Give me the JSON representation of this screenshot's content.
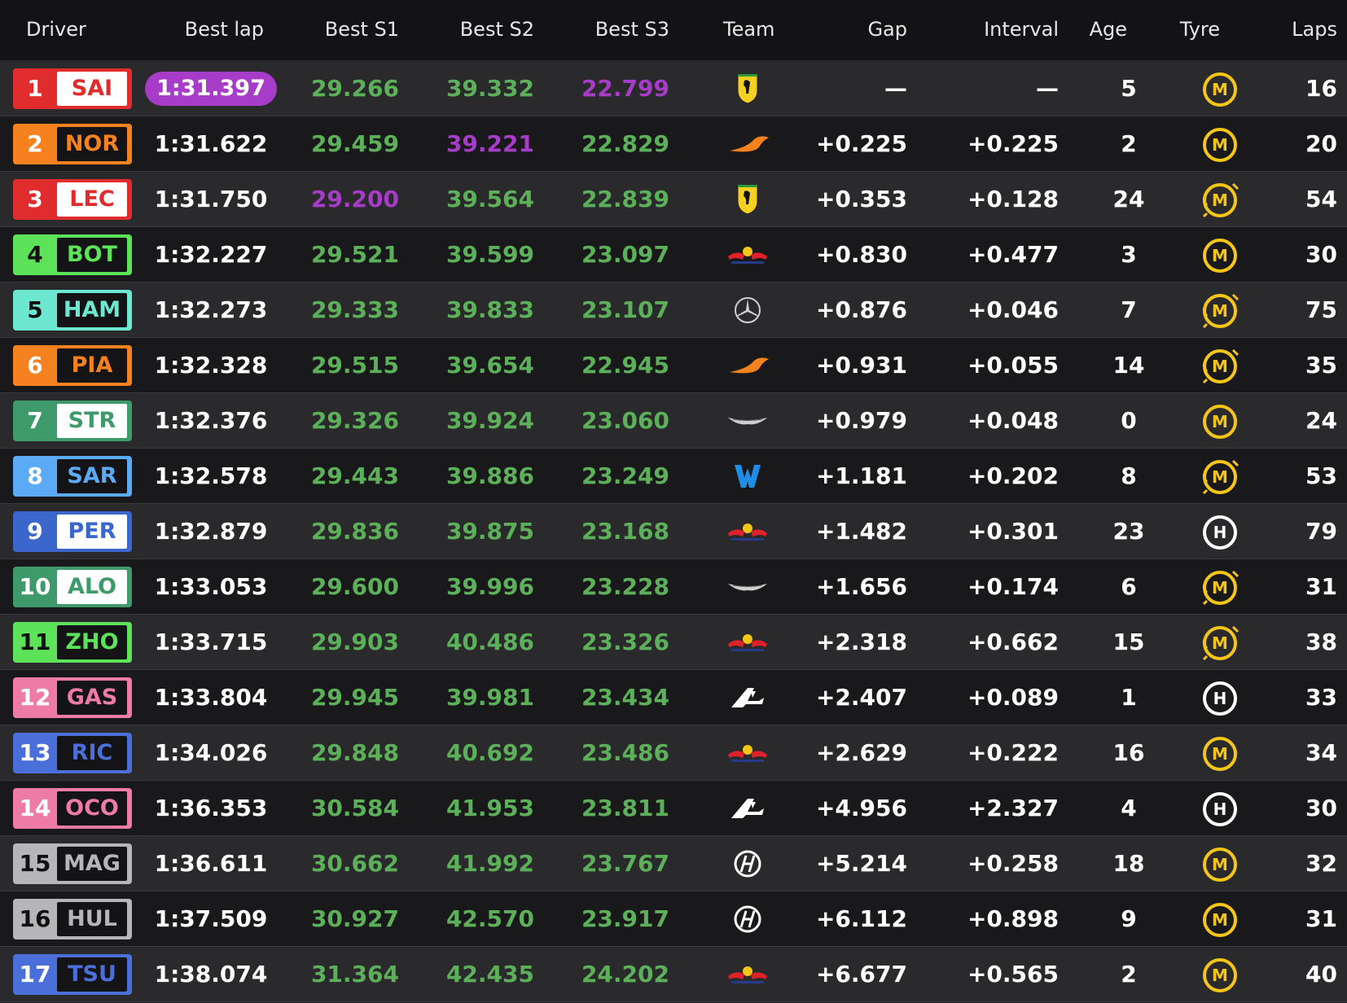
{
  "headers": {
    "driver": "Driver",
    "best_lap": "Best lap",
    "best_s1": "Best S1",
    "best_s2": "Best S2",
    "best_s3": "Best S3",
    "team": "Team",
    "gap": "Gap",
    "interval": "Interval",
    "age": "Age",
    "tyre": "Tyre",
    "laps": "Laps"
  },
  "colors": {
    "personal_best": "#5db05a",
    "overall_best": "#a63cc8",
    "medium_tyre": "#f5c518",
    "hard_tyre": "#ffffff"
  },
  "rows": [
    {
      "pos": "1",
      "code": "SAI",
      "team_color": "#e02c2c",
      "best_lap": "1:31.397",
      "best_lap_fastest": true,
      "s1": "29.266",
      "s1_color": "green",
      "s2": "39.332",
      "s2_color": "green",
      "s3": "22.799",
      "s3_color": "purple",
      "team_icon": "ferrari-icon",
      "gap": "—",
      "interval": "—",
      "age": "5",
      "tyre": "M",
      "tyre_icon": "medium-tyre-icon",
      "tyre_used": false,
      "laps": "16"
    },
    {
      "pos": "2",
      "code": "NOR",
      "team_color": "#f5821f",
      "best_lap": "1:31.622",
      "best_lap_fastest": false,
      "s1": "29.459",
      "s1_color": "green",
      "s2": "39.221",
      "s2_color": "purple",
      "s3": "22.829",
      "s3_color": "green",
      "team_icon": "mclaren-icon",
      "gap": "+0.225",
      "interval": "+0.225",
      "age": "2",
      "tyre": "M",
      "tyre_icon": "medium-tyre-icon",
      "tyre_used": false,
      "laps": "20"
    },
    {
      "pos": "3",
      "code": "LEC",
      "team_color": "#e02c2c",
      "best_lap": "1:31.750",
      "best_lap_fastest": false,
      "s1": "29.200",
      "s1_color": "purple",
      "s2": "39.564",
      "s2_color": "green",
      "s3": "22.839",
      "s3_color": "green",
      "team_icon": "ferrari-icon",
      "gap": "+0.353",
      "interval": "+0.128",
      "age": "24",
      "tyre": "M",
      "tyre_icon": "medium-tyre-used-icon",
      "tyre_used": true,
      "laps": "54"
    },
    {
      "pos": "4",
      "code": "BOT",
      "team_color": "#5de35a",
      "best_lap": "1:32.227",
      "best_lap_fastest": false,
      "s1": "29.521",
      "s1_color": "green",
      "s2": "39.599",
      "s2_color": "green",
      "s3": "23.097",
      "s3_color": "green",
      "team_icon": "red-bull-icon",
      "gap": "+0.830",
      "interval": "+0.477",
      "age": "3",
      "tyre": "M",
      "tyre_icon": "medium-tyre-icon",
      "tyre_used": false,
      "laps": "30"
    },
    {
      "pos": "5",
      "code": "HAM",
      "team_color": "#6de8d0",
      "best_lap": "1:32.273",
      "best_lap_fastest": false,
      "s1": "29.333",
      "s1_color": "green",
      "s2": "39.833",
      "s2_color": "green",
      "s3": "23.107",
      "s3_color": "green",
      "team_icon": "mercedes-icon",
      "gap": "+0.876",
      "interval": "+0.046",
      "age": "7",
      "tyre": "M",
      "tyre_icon": "medium-tyre-used-icon",
      "tyre_used": true,
      "laps": "75"
    },
    {
      "pos": "6",
      "code": "PIA",
      "team_color": "#f5821f",
      "best_lap": "1:32.328",
      "best_lap_fastest": false,
      "s1": "29.515",
      "s1_color": "green",
      "s2": "39.654",
      "s2_color": "green",
      "s3": "22.945",
      "s3_color": "green",
      "team_icon": "mclaren-icon",
      "gap": "+0.931",
      "interval": "+0.055",
      "age": "14",
      "tyre": "M",
      "tyre_icon": "medium-tyre-used-icon",
      "tyre_used": true,
      "laps": "35"
    },
    {
      "pos": "7",
      "code": "STR",
      "team_color": "#3e9a6a",
      "best_lap": "1:32.376",
      "best_lap_fastest": false,
      "s1": "29.326",
      "s1_color": "green",
      "s2": "39.924",
      "s2_color": "green",
      "s3": "23.060",
      "s3_color": "green",
      "team_icon": "aston-martin-icon",
      "gap": "+0.979",
      "interval": "+0.048",
      "age": "0",
      "tyre": "M",
      "tyre_icon": "medium-tyre-icon",
      "tyre_used": false,
      "laps": "24"
    },
    {
      "pos": "8",
      "code": "SAR",
      "team_color": "#5aaaf5",
      "best_lap": "1:32.578",
      "best_lap_fastest": false,
      "s1": "29.443",
      "s1_color": "green",
      "s2": "39.886",
      "s2_color": "green",
      "s3": "23.249",
      "s3_color": "green",
      "team_icon": "williams-icon",
      "gap": "+1.181",
      "interval": "+0.202",
      "age": "8",
      "tyre": "M",
      "tyre_icon": "medium-tyre-used-icon",
      "tyre_used": true,
      "laps": "53"
    },
    {
      "pos": "9",
      "code": "PER",
      "team_color": "#3b67cc",
      "best_lap": "1:32.879",
      "best_lap_fastest": false,
      "s1": "29.836",
      "s1_color": "green",
      "s2": "39.875",
      "s2_color": "green",
      "s3": "23.168",
      "s3_color": "green",
      "team_icon": "red-bull-icon",
      "gap": "+1.482",
      "interval": "+0.301",
      "age": "23",
      "tyre": "H",
      "tyre_icon": "hard-tyre-icon",
      "tyre_used": false,
      "laps": "79"
    },
    {
      "pos": "10",
      "code": "ALO",
      "team_color": "#3e9a6a",
      "best_lap": "1:33.053",
      "best_lap_fastest": false,
      "s1": "29.600",
      "s1_color": "green",
      "s2": "39.996",
      "s2_color": "green",
      "s3": "23.228",
      "s3_color": "green",
      "team_icon": "aston-martin-icon",
      "gap": "+1.656",
      "interval": "+0.174",
      "age": "6",
      "tyre": "M",
      "tyre_icon": "medium-tyre-used-icon",
      "tyre_used": true,
      "laps": "31"
    },
    {
      "pos": "11",
      "code": "ZHO",
      "team_color": "#5de35a",
      "best_lap": "1:33.715",
      "best_lap_fastest": false,
      "s1": "29.903",
      "s1_color": "green",
      "s2": "40.486",
      "s2_color": "green",
      "s3": "23.326",
      "s3_color": "green",
      "team_icon": "red-bull-icon",
      "gap": "+2.318",
      "interval": "+0.662",
      "age": "15",
      "tyre": "M",
      "tyre_icon": "medium-tyre-used-icon",
      "tyre_used": true,
      "laps": "38"
    },
    {
      "pos": "12",
      "code": "GAS",
      "team_color": "#ee7aa6",
      "best_lap": "1:33.804",
      "best_lap_fastest": false,
      "s1": "29.945",
      "s1_color": "green",
      "s2": "39.981",
      "s2_color": "green",
      "s3": "23.434",
      "s3_color": "green",
      "team_icon": "alpine-icon",
      "gap": "+2.407",
      "interval": "+0.089",
      "age": "1",
      "tyre": "H",
      "tyre_icon": "hard-tyre-icon",
      "tyre_used": false,
      "laps": "33"
    },
    {
      "pos": "13",
      "code": "RIC",
      "team_color": "#4a6fd8",
      "best_lap": "1:34.026",
      "best_lap_fastest": false,
      "s1": "29.848",
      "s1_color": "green",
      "s2": "40.692",
      "s2_color": "green",
      "s3": "23.486",
      "s3_color": "green",
      "team_icon": "red-bull-icon",
      "gap": "+2.629",
      "interval": "+0.222",
      "age": "16",
      "tyre": "M",
      "tyre_icon": "medium-tyre-icon",
      "tyre_used": false,
      "laps": "34"
    },
    {
      "pos": "14",
      "code": "OCO",
      "team_color": "#ee7aa6",
      "best_lap": "1:36.353",
      "best_lap_fastest": false,
      "s1": "30.584",
      "s1_color": "green",
      "s2": "41.953",
      "s2_color": "green",
      "s3": "23.811",
      "s3_color": "green",
      "team_icon": "alpine-icon",
      "gap": "+4.956",
      "interval": "+2.327",
      "age": "4",
      "tyre": "H",
      "tyre_icon": "hard-tyre-icon",
      "tyre_used": false,
      "laps": "30"
    },
    {
      "pos": "15",
      "code": "MAG",
      "team_color": "#b6b6b8",
      "best_lap": "1:36.611",
      "best_lap_fastest": false,
      "s1": "30.662",
      "s1_color": "green",
      "s2": "41.992",
      "s2_color": "green",
      "s3": "23.767",
      "s3_color": "green",
      "team_icon": "haas-icon",
      "gap": "+5.214",
      "interval": "+0.258",
      "age": "18",
      "tyre": "M",
      "tyre_icon": "medium-tyre-icon",
      "tyre_used": false,
      "laps": "32"
    },
    {
      "pos": "16",
      "code": "HUL",
      "team_color": "#b6b6b8",
      "best_lap": "1:37.509",
      "best_lap_fastest": false,
      "s1": "30.927",
      "s1_color": "green",
      "s2": "42.570",
      "s2_color": "green",
      "s3": "23.917",
      "s3_color": "green",
      "team_icon": "haas-icon",
      "gap": "+6.112",
      "interval": "+0.898",
      "age": "9",
      "tyre": "M",
      "tyre_icon": "medium-tyre-icon",
      "tyre_used": false,
      "laps": "31"
    },
    {
      "pos": "17",
      "code": "TSU",
      "team_color": "#4a6fd8",
      "best_lap": "1:38.074",
      "best_lap_fastest": false,
      "s1": "31.364",
      "s1_color": "green",
      "s2": "42.435",
      "s2_color": "green",
      "s3": "24.202",
      "s3_color": "green",
      "team_icon": "red-bull-icon",
      "gap": "+6.677",
      "interval": "+0.565",
      "age": "2",
      "tyre": "M",
      "tyre_icon": "medium-tyre-icon",
      "tyre_used": false,
      "laps": "40"
    }
  ]
}
